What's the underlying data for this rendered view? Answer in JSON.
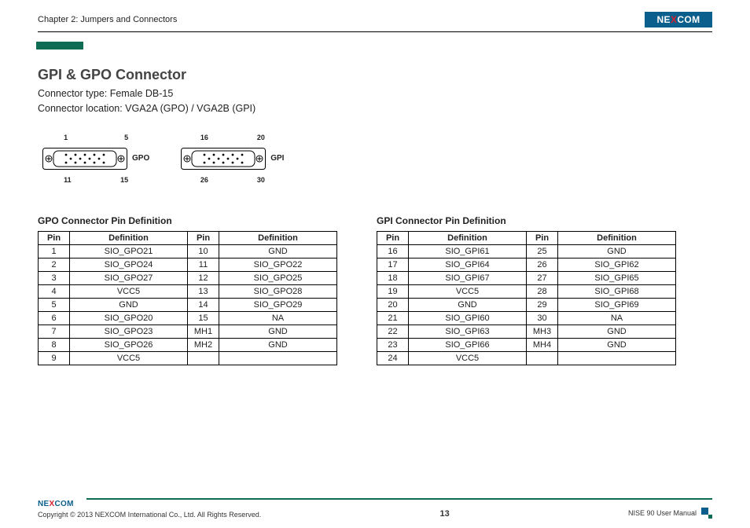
{
  "header": {
    "chapter": "Chapter 2: Jumpers and Connectors",
    "logo_pre": "NE",
    "logo_x": "X",
    "logo_post": "COM"
  },
  "title": "GPI & GPO Connector",
  "meta_line1": "Connector type: Female DB-15",
  "meta_line2": "Connector location: VGA2A (GPO) / VGA2B (GPI)",
  "conn": {
    "gpo": {
      "tl": "1",
      "tr": "5",
      "bl": "11",
      "br": "15",
      "label": "GPO"
    },
    "gpi": {
      "tl": "16",
      "tr": "20",
      "bl": "26",
      "br": "30",
      "label": "GPI"
    }
  },
  "gpo": {
    "title": "GPO Connector Pin Definition",
    "hdr": {
      "pin": "Pin",
      "def": "Definition"
    },
    "left": [
      {
        "pin": "1",
        "def": "SIO_GPO21"
      },
      {
        "pin": "2",
        "def": "SIO_GPO24"
      },
      {
        "pin": "3",
        "def": "SIO_GPO27"
      },
      {
        "pin": "4",
        "def": "VCC5"
      },
      {
        "pin": "5",
        "def": "GND"
      },
      {
        "pin": "6",
        "def": "SIO_GPO20"
      },
      {
        "pin": "7",
        "def": "SIO_GPO23"
      },
      {
        "pin": "8",
        "def": "SIO_GPO26"
      },
      {
        "pin": "9",
        "def": "VCC5"
      }
    ],
    "right": [
      {
        "pin": "10",
        "def": "GND"
      },
      {
        "pin": "11",
        "def": "SIO_GPO22"
      },
      {
        "pin": "12",
        "def": "SIO_GPO25"
      },
      {
        "pin": "13",
        "def": "SIO_GPO28"
      },
      {
        "pin": "14",
        "def": "SIO_GPO29"
      },
      {
        "pin": "15",
        "def": "NA"
      },
      {
        "pin": "MH1",
        "def": "GND"
      },
      {
        "pin": "MH2",
        "def": "GND"
      },
      {
        "pin": "",
        "def": ""
      }
    ]
  },
  "gpi": {
    "title": "GPI Connector Pin Definition",
    "hdr": {
      "pin": "Pin",
      "def": "Definition"
    },
    "left": [
      {
        "pin": "16",
        "def": "SIO_GPI61"
      },
      {
        "pin": "17",
        "def": "SIO_GPI64"
      },
      {
        "pin": "18",
        "def": "SIO_GPI67"
      },
      {
        "pin": "19",
        "def": "VCC5"
      },
      {
        "pin": "20",
        "def": "GND"
      },
      {
        "pin": "21",
        "def": "SIO_GPI60"
      },
      {
        "pin": "22",
        "def": "SIO_GPI63"
      },
      {
        "pin": "23",
        "def": "SIO_GPI66"
      },
      {
        "pin": "24",
        "def": "VCC5"
      }
    ],
    "right": [
      {
        "pin": "25",
        "def": "GND"
      },
      {
        "pin": "26",
        "def": "SIO_GPI62"
      },
      {
        "pin": "27",
        "def": "SIO_GPI65"
      },
      {
        "pin": "28",
        "def": "SIO_GPI68"
      },
      {
        "pin": "29",
        "def": "SIO_GPI69"
      },
      {
        "pin": "30",
        "def": "NA"
      },
      {
        "pin": "MH3",
        "def": "GND"
      },
      {
        "pin": "MH4",
        "def": "GND"
      },
      {
        "pin": "",
        "def": ""
      }
    ]
  },
  "footer": {
    "logo_pre": "NE",
    "logo_x": "X",
    "logo_post": "COM",
    "copyright": "Copyright © 2013 NEXCOM International Co., Ltd. All Rights Reserved.",
    "page": "13",
    "manual": "NISE 90 User Manual"
  }
}
